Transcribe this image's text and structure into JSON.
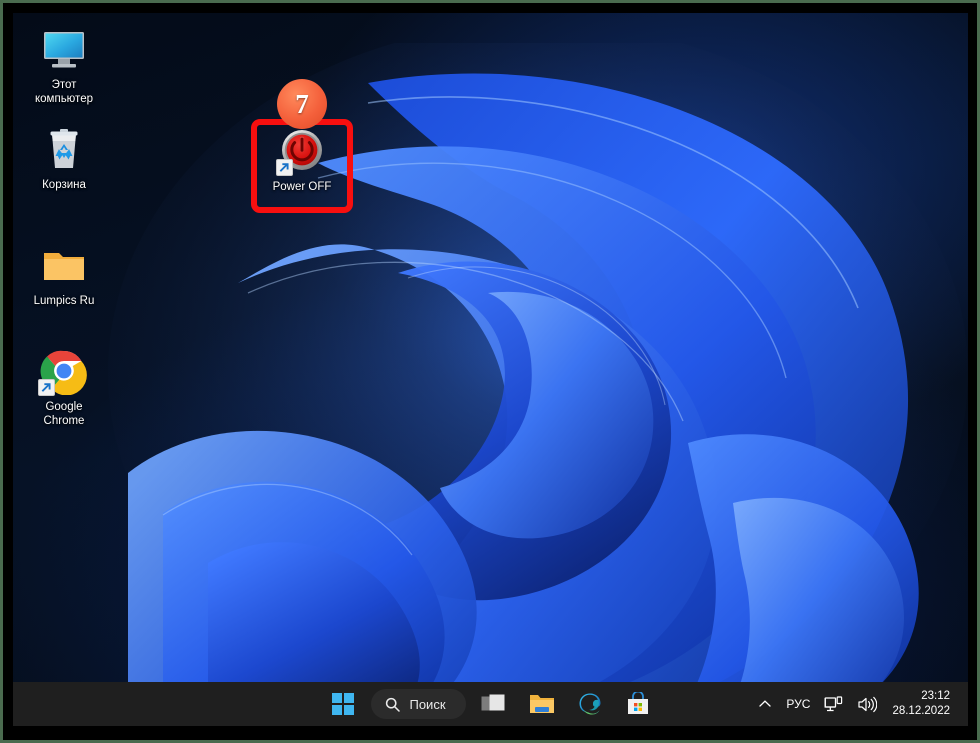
{
  "window": {
    "title": "Windows 11 Desktop",
    "frame_color": "#4a6b4f",
    "matte_color": "#000000"
  },
  "desktop": {
    "background_color": "#050d1c",
    "wallpaper_name": "windows-11-bloom-wallpaper",
    "icons": [
      {
        "id": "this-pc",
        "label_line1": "Этот",
        "label_line2": "компьютер",
        "icon_name": "monitor-icon",
        "shortcut_overlay": false
      },
      {
        "id": "recycle-bin",
        "label_line1": "Корзина",
        "label_line2": "",
        "icon_name": "recycle-bin-icon",
        "shortcut_overlay": false
      },
      {
        "id": "lumpics-ru-folder",
        "label_line1": "Lumpics Ru",
        "label_line2": "",
        "icon_name": "folder-icon",
        "shortcut_overlay": false
      },
      {
        "id": "google-chrome",
        "label_line1": "Google",
        "label_line2": "Chrome",
        "icon_name": "chrome-icon",
        "shortcut_overlay": true
      },
      {
        "id": "power-off",
        "label_line1": "Power OFF",
        "label_line2": "",
        "icon_name": "power-button-icon",
        "shortcut_overlay": true
      }
    ]
  },
  "annotation": {
    "step_number": "7",
    "badge_color": "#f4603b",
    "highlight_color": "#f70f0f",
    "highlight_target": "power-off"
  },
  "taskbar": {
    "background_color": "#1f1f1f",
    "start_label": "Пуск",
    "search": {
      "placeholder": "Поиск",
      "value": "Поиск",
      "icon_name": "search-icon"
    },
    "buttons": [
      {
        "id": "start",
        "label": "Пуск",
        "icon_name": "windows-logo-icon"
      },
      {
        "id": "task-view",
        "label": "Представление задач",
        "icon_name": "task-view-icon"
      },
      {
        "id": "file-explorer",
        "label": "Проводник",
        "icon_name": "folder-icon"
      },
      {
        "id": "edge",
        "label": "Microsoft Edge",
        "icon_name": "edge-icon"
      },
      {
        "id": "microsoft-store",
        "label": "Microsoft Store",
        "icon_name": "store-icon"
      }
    ],
    "tray": {
      "overflow_icon": "chevron-up-icon",
      "language": "РУС",
      "network_icon": "network-icon",
      "volume_icon": "volume-icon",
      "time": "23:12",
      "date": "28.12.2022"
    }
  }
}
